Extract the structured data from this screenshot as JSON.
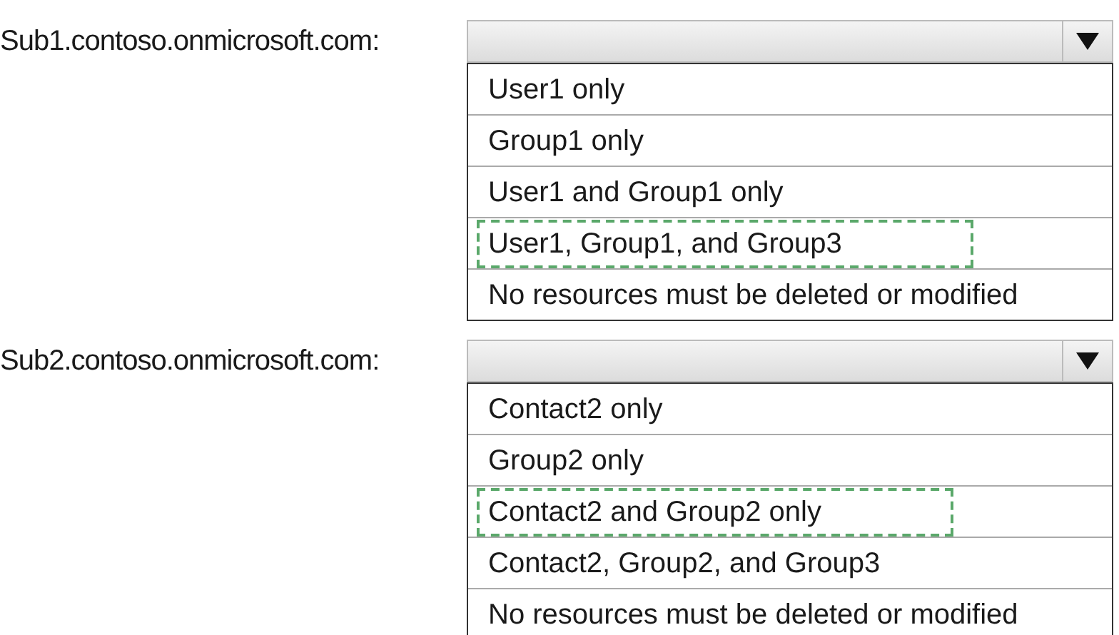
{
  "dropdowns": [
    {
      "label": "Sub1.contoso.onmicrosoft.com:",
      "options": [
        {
          "text": "User1 only",
          "selected": false
        },
        {
          "text": "Group1 only",
          "selected": false
        },
        {
          "text": "User1 and Group1 only",
          "selected": false
        },
        {
          "text": "User1, Group1, and Group3",
          "selected": true
        },
        {
          "text": "No resources must be deleted or modified",
          "selected": false
        }
      ]
    },
    {
      "label": "Sub2.contoso.onmicrosoft.com:",
      "options": [
        {
          "text": "Contact2 only",
          "selected": false
        },
        {
          "text": "Group2 only",
          "selected": false
        },
        {
          "text": "Contact2 and Group2 only",
          "selected": true
        },
        {
          "text": "Contact2, Group2, and Group3",
          "selected": false
        },
        {
          "text": "No resources must be deleted or modified",
          "selected": false
        }
      ]
    }
  ]
}
